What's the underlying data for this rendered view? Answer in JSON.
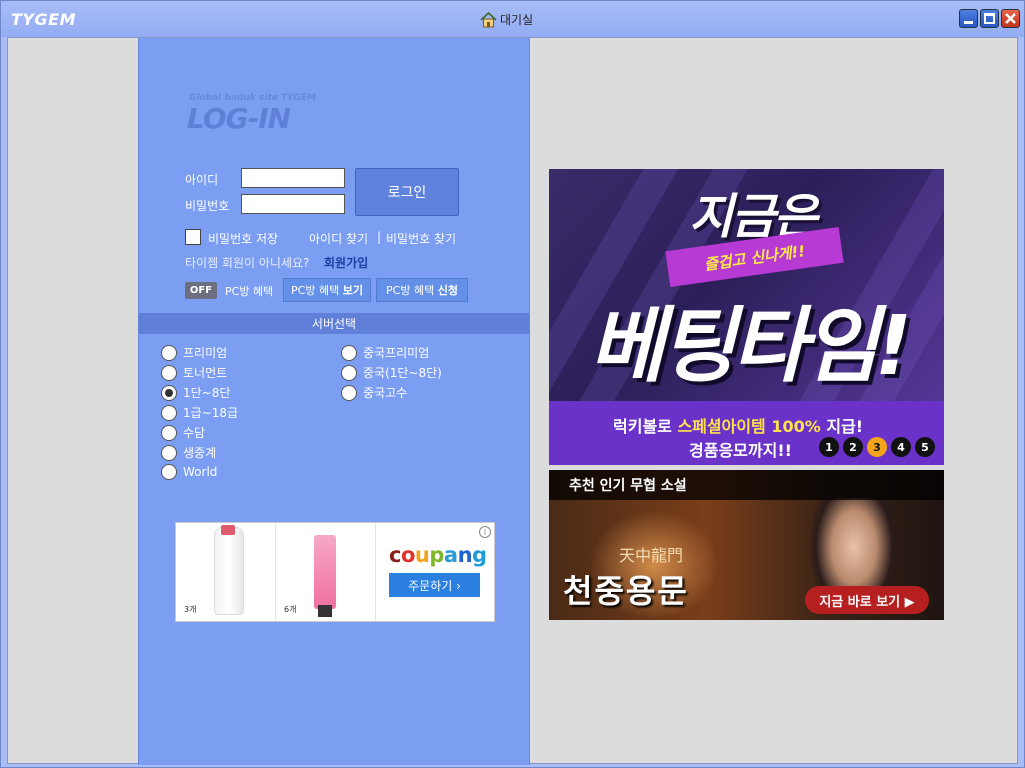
{
  "window": {
    "logo": "TYGEM",
    "title": "대기실",
    "title_icon": "home-icon",
    "controls": [
      "minimize-icon",
      "maximize-icon",
      "close-icon"
    ]
  },
  "login": {
    "subtitle": "Global baduk site TYGEM",
    "title": "LOG-IN",
    "id_label": "아이디",
    "pw_label": "비밀번호",
    "id_value": "",
    "pw_value": "",
    "login_button": "로그인",
    "save_pw_label": "비밀번호 저장",
    "find_id": "아이디 찾기",
    "separator": "|",
    "find_pw": "비밀번호 찾기",
    "not_member": "타이젬 회원이 아니세요?",
    "join": "회원가입",
    "toggle": "OFF",
    "pc_benefit": "PC방 혜택",
    "pc_view_prefix": "PC방 혜택",
    "pc_view_bold": "보기",
    "pc_apply_prefix": "PC방 혜택",
    "pc_apply_bold": "신청"
  },
  "server": {
    "header": "서버선택",
    "left": [
      {
        "label": "프리미엄",
        "selected": false
      },
      {
        "label": "토너먼트",
        "selected": false
      },
      {
        "label": "1단~8단",
        "selected": true
      },
      {
        "label": "1급~18급",
        "selected": false
      },
      {
        "label": "수담",
        "selected": false
      },
      {
        "label": "생중계",
        "selected": false
      },
      {
        "label": "World",
        "selected": false
      }
    ],
    "right": [
      {
        "label": "중국프리미엄",
        "selected": false
      },
      {
        "label": "중국(1단~8단)",
        "selected": false
      },
      {
        "label": "중국고수",
        "selected": false
      }
    ]
  },
  "ad_coupang": {
    "item1_num": "3개",
    "item2_num": "6개",
    "brand_letters": [
      "c",
      "o",
      "u",
      "p",
      "a",
      "n",
      "g"
    ],
    "order_button": "주문하기 ›",
    "info": "i"
  },
  "banner1": {
    "top": "지금은",
    "ribbon": "즐겁고 신나게!!",
    "main": "베팅타임!",
    "line1_prefix": "럭키볼로 ",
    "line1_highlight": "스페셜아이템 100%",
    "line1_suffix": " 지급!",
    "line2": "경품응모까지!!",
    "pages": [
      "1",
      "2",
      "3",
      "4",
      "5"
    ],
    "active_page": "3"
  },
  "banner2": {
    "header": "추천 인기 무협 소설",
    "hanja": "天中龍門",
    "title": "천중용문",
    "button": "지금 바로 보기 ▶"
  }
}
